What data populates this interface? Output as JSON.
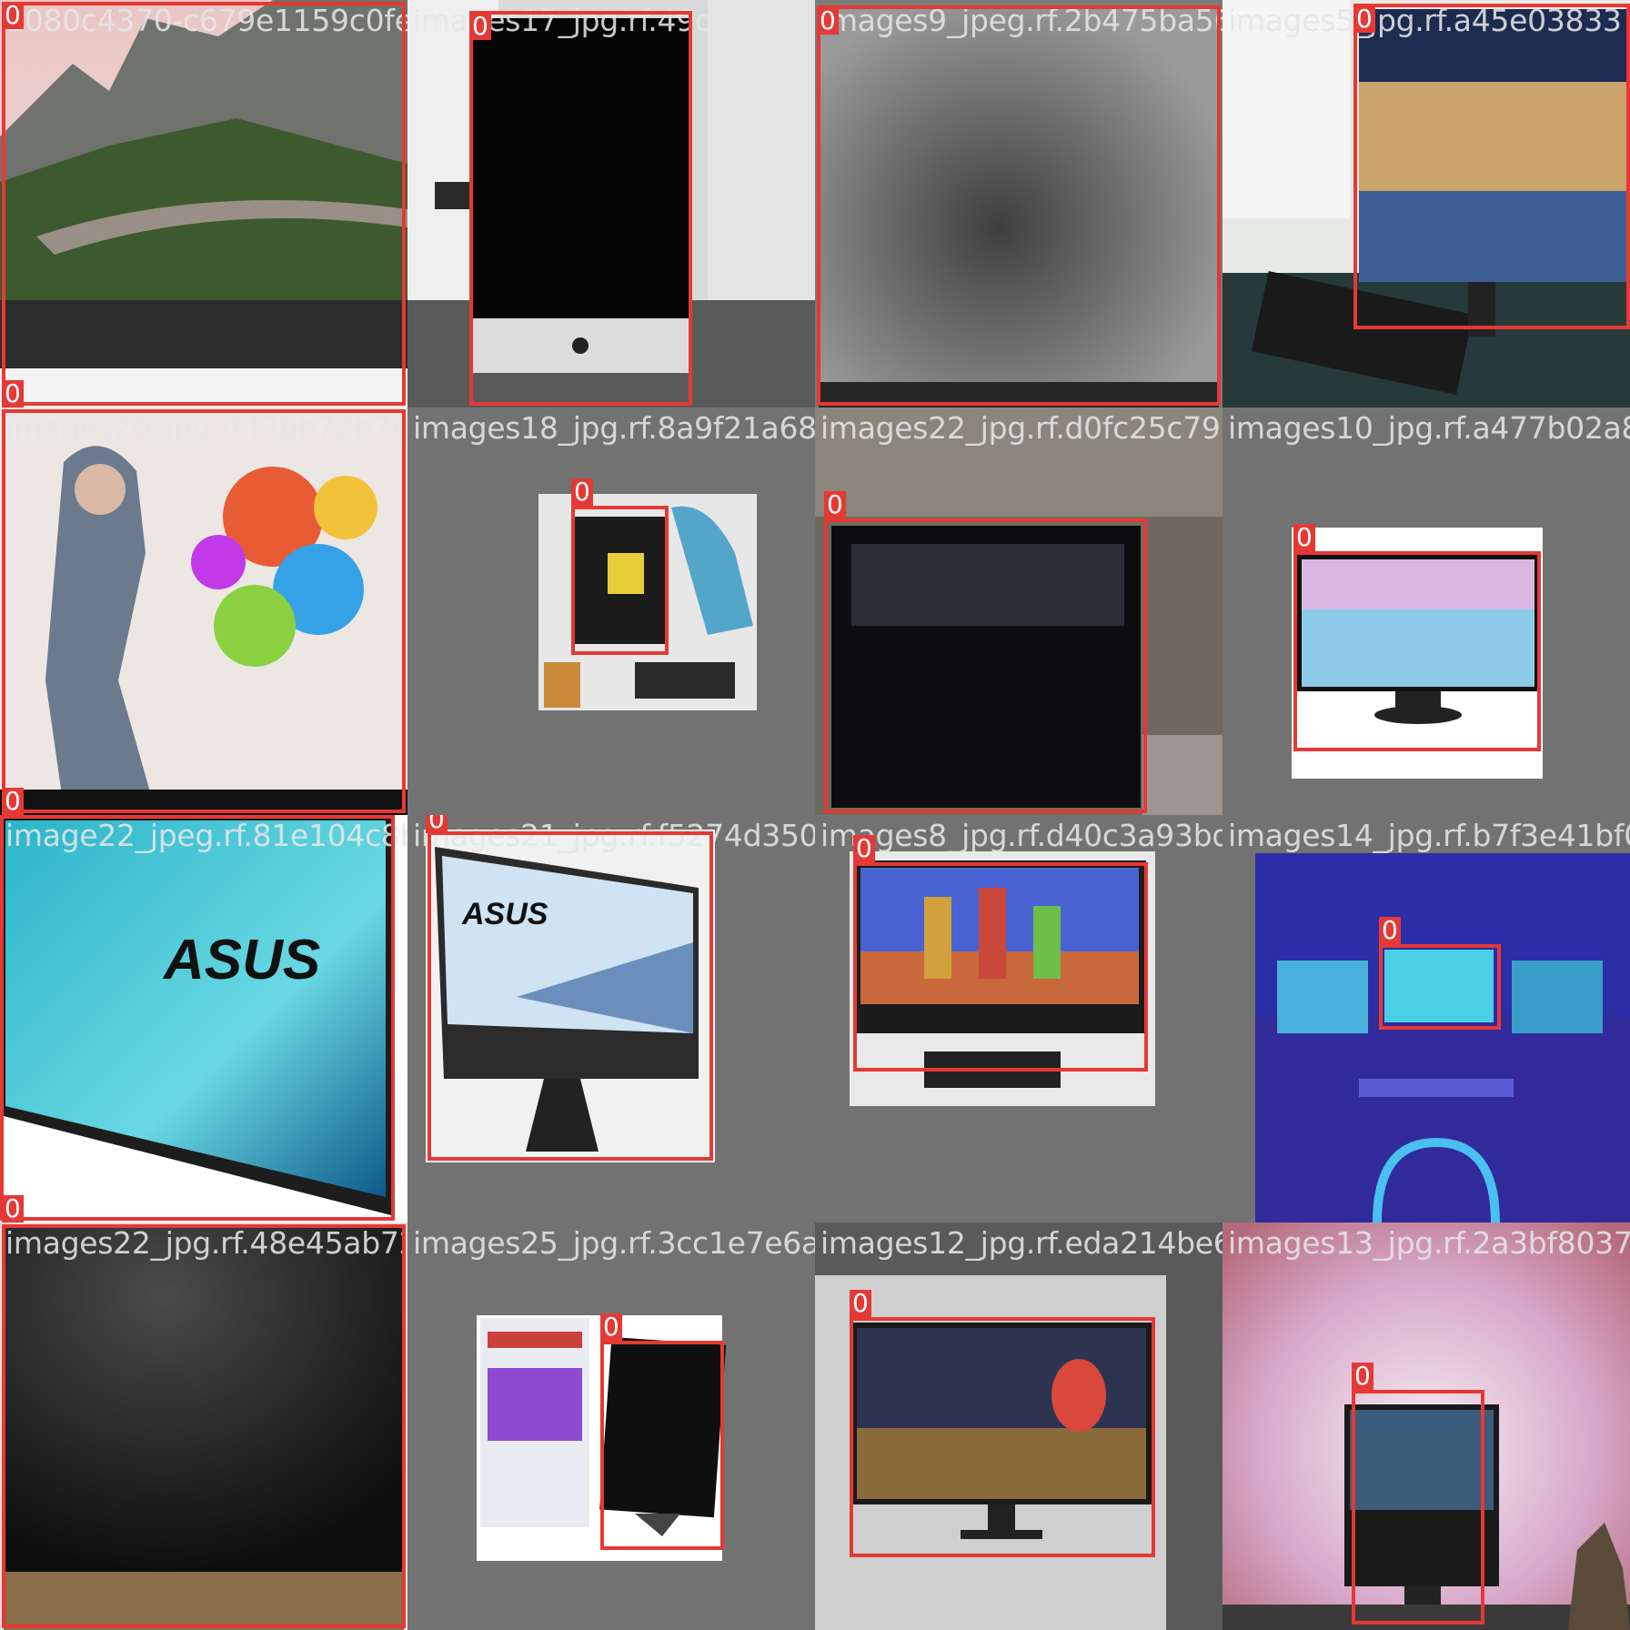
{
  "mosaic": {
    "box_color": "#e53935",
    "tiles": [
      {
        "filename": "1080c4370-c679e1159c0fe5",
        "label": "0"
      },
      {
        "filename": "images17_jpg.rf.49d7b9ae",
        "label": "0"
      },
      {
        "filename": "images9_jpeg.rf.2b475ba569f7",
        "label": "0"
      },
      {
        "filename": "images5_jpg.rf.a45e03833",
        "label": "0"
      },
      {
        "filename": "images20_jpg.rf.f3bb72b7c35f009f0783f28",
        "label": "0"
      },
      {
        "filename": "images18_jpg.rf.8a9f21a688e07a0872e7ff1",
        "label": "0"
      },
      {
        "filename": "images22_jpg.rf.d0fc25c7939f0afda75076",
        "label": "0"
      },
      {
        "filename": "images10_jpg.rf.a477b02a85",
        "label": "0"
      },
      {
        "filename": "image22_jpeg.rf.81e104c8b56c",
        "label": "0"
      },
      {
        "filename": "images21_jpg.rf.f5274d3502a2e2",
        "label": "0"
      },
      {
        "filename": "images8_jpg.rf.d40c3a93bd414ba",
        "label": "0"
      },
      {
        "filename": "images14_jpg.rf.b7f3e41bf0",
        "label": "0"
      },
      {
        "filename": "images22_jpg.rf.48e45ab727",
        "label": "0"
      },
      {
        "filename": "images25_jpg.rf.3cc1e7e6a14df8791",
        "label": "0"
      },
      {
        "filename": "images12_jpg.rf.eda214be68b157293",
        "label": "0"
      },
      {
        "filename": "images13_jpg.rf.2a3bf80374",
        "label": "0"
      }
    ]
  }
}
